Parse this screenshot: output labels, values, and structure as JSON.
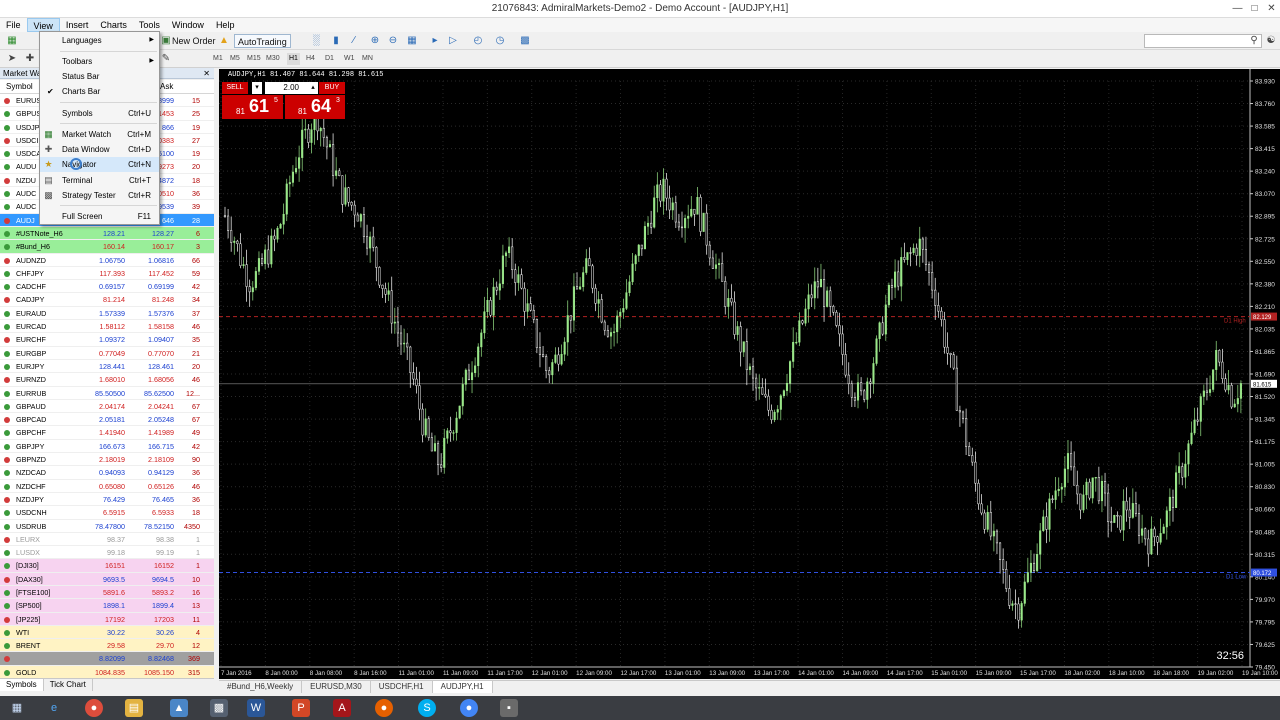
{
  "window": {
    "title": "21076843: AdmiralMarkets-Demo2 - Demo Account - [AUDJPY,H1]"
  },
  "menubar": [
    "File",
    "View",
    "Insert",
    "Charts",
    "Tools",
    "Window",
    "Help"
  ],
  "toolbar": {
    "new_order": "New Order",
    "autotrading": "AutoTrading"
  },
  "timeframes": [
    "M1",
    "M5",
    "M15",
    "M30",
    "H1",
    "H4",
    "D1",
    "W1",
    "MN"
  ],
  "view_menu": [
    {
      "label": "Languages",
      "shortcut": "",
      "submenu": true
    },
    {
      "label": "Toolbars",
      "shortcut": "",
      "submenu": true
    },
    {
      "label": "Status Bar",
      "shortcut": ""
    },
    {
      "label": "Charts Bar",
      "shortcut": "",
      "checked": true
    },
    {
      "label": "Symbols",
      "shortcut": "Ctrl+U"
    },
    {
      "label": "Market Watch",
      "shortcut": "Ctrl+M"
    },
    {
      "label": "Data Window",
      "shortcut": "Ctrl+D"
    },
    {
      "label": "Navigator",
      "shortcut": "Ctrl+N"
    },
    {
      "label": "Terminal",
      "shortcut": "Ctrl+T"
    },
    {
      "label": "Strategy Tester",
      "shortcut": "Ctrl+R"
    },
    {
      "label": "Full Screen",
      "shortcut": "F11"
    }
  ],
  "market_watch": {
    "title": "Market Wa",
    "columns": {
      "symbol": "Symbol",
      "ask": "Ask"
    },
    "rows": [
      {
        "symbol": "EURUS",
        "bid": "",
        "ask": "8999",
        "spread": "15",
        "bg": "#ffffff"
      },
      {
        "symbol": "GBPUS",
        "bid": "",
        "ask": "1453",
        "spread": "25",
        "bg": "#ffffff"
      },
      {
        "symbol": "USDJP",
        "bid": "",
        "ask": "866",
        "spread": "19",
        "bg": "#ffffff"
      },
      {
        "symbol": "USDCI",
        "bid": "",
        "ask": "0383",
        "spread": "27",
        "bg": "#ffffff"
      },
      {
        "symbol": "USDCA",
        "bid": "",
        "ask": "5100",
        "spread": "19",
        "bg": "#ffffff"
      },
      {
        "symbol": "AUDU",
        "bid": "",
        "ask": "9273",
        "spread": "20",
        "bg": "#ffffff"
      },
      {
        "symbol": "NZDU",
        "bid": "",
        "ask": "4872",
        "spread": "18",
        "bg": "#ffffff"
      },
      {
        "symbol": "AUDC",
        "bid": "",
        "ask": "0510",
        "spread": "36",
        "bg": "#ffffff"
      },
      {
        "symbol": "AUDC",
        "bid": "",
        "ask": "9539",
        "spread": "39",
        "bg": "#ffffff"
      },
      {
        "symbol": "AUDJ",
        "bid": "",
        "ask": "646",
        "spread": "28",
        "bg": "#3399ff"
      },
      {
        "symbol": "#USTNote_H6",
        "bid": "128.21",
        "ask": "128.27",
        "spread": "6",
        "bg": "#99ee99"
      },
      {
        "symbol": "#Bund_H6",
        "bid": "160.14",
        "ask": "160.17",
        "spread": "3",
        "bg": "#99ee99"
      },
      {
        "symbol": "AUDNZD",
        "bid": "1.06750",
        "ask": "1.06816",
        "spread": "66",
        "bg": "#ffffff"
      },
      {
        "symbol": "CHFJPY",
        "bid": "117.393",
        "ask": "117.452",
        "spread": "59",
        "bg": "#ffffff"
      },
      {
        "symbol": "CADCHF",
        "bid": "0.69157",
        "ask": "0.69199",
        "spread": "42",
        "bg": "#ffffff"
      },
      {
        "symbol": "CADJPY",
        "bid": "81.214",
        "ask": "81.248",
        "spread": "34",
        "bg": "#ffffff"
      },
      {
        "symbol": "EURAUD",
        "bid": "1.57339",
        "ask": "1.57376",
        "spread": "37",
        "bg": "#ffffff"
      },
      {
        "symbol": "EURCAD",
        "bid": "1.58112",
        "ask": "1.58158",
        "spread": "46",
        "bg": "#ffffff"
      },
      {
        "symbol": "EURCHF",
        "bid": "1.09372",
        "ask": "1.09407",
        "spread": "35",
        "bg": "#ffffff"
      },
      {
        "symbol": "EURGBP",
        "bid": "0.77049",
        "ask": "0.77070",
        "spread": "21",
        "bg": "#ffffff"
      },
      {
        "symbol": "EURJPY",
        "bid": "128.441",
        "ask": "128.461",
        "spread": "20",
        "bg": "#ffffff"
      },
      {
        "symbol": "EURNZD",
        "bid": "1.68010",
        "ask": "1.68056",
        "spread": "46",
        "bg": "#ffffff"
      },
      {
        "symbol": "EURRUB",
        "bid": "85.50500",
        "ask": "85.62500",
        "spread": "12...",
        "bg": "#ffffff"
      },
      {
        "symbol": "GBPAUD",
        "bid": "2.04174",
        "ask": "2.04241",
        "spread": "67",
        "bg": "#ffffff"
      },
      {
        "symbol": "GBPCAD",
        "bid": "2.05181",
        "ask": "2.05248",
        "spread": "67",
        "bg": "#ffffff"
      },
      {
        "symbol": "GBPCHF",
        "bid": "1.41940",
        "ask": "1.41989",
        "spread": "49",
        "bg": "#ffffff"
      },
      {
        "symbol": "GBPJPY",
        "bid": "166.673",
        "ask": "166.715",
        "spread": "42",
        "bg": "#ffffff"
      },
      {
        "symbol": "GBPNZD",
        "bid": "2.18019",
        "ask": "2.18109",
        "spread": "90",
        "bg": "#ffffff"
      },
      {
        "symbol": "NZDCAD",
        "bid": "0.94093",
        "ask": "0.94129",
        "spread": "36",
        "bg": "#ffffff"
      },
      {
        "symbol": "NZDCHF",
        "bid": "0.65080",
        "ask": "0.65126",
        "spread": "46",
        "bg": "#ffffff"
      },
      {
        "symbol": "NZDJPY",
        "bid": "76.429",
        "ask": "76.465",
        "spread": "36",
        "bg": "#ffffff"
      },
      {
        "symbol": "USDCNH",
        "bid": "6.5915",
        "ask": "6.5933",
        "spread": "18",
        "bg": "#ffffff"
      },
      {
        "symbol": "USDRUB",
        "bid": "78.47800",
        "ask": "78.52150",
        "spread": "4350",
        "bg": "#ffffff"
      },
      {
        "symbol": "LEURX",
        "bid": "98.37",
        "ask": "98.38",
        "spread": "1",
        "bg": "#ffffff",
        "grey": true
      },
      {
        "symbol": "LUSDX",
        "bid": "99.18",
        "ask": "99.19",
        "spread": "1",
        "bg": "#ffffff",
        "grey": true
      },
      {
        "symbol": "[DJI30]",
        "bid": "16151",
        "ask": "16152",
        "spread": "1",
        "bg": "#f7d3f0"
      },
      {
        "symbol": "[DAX30]",
        "bid": "9693.5",
        "ask": "9694.5",
        "spread": "10",
        "bg": "#f7d3f0"
      },
      {
        "symbol": "[FTSE100]",
        "bid": "5891.6",
        "ask": "5893.2",
        "spread": "16",
        "bg": "#f7d3f0"
      },
      {
        "symbol": "[SP500]",
        "bid": "1898.1",
        "ask": "1899.4",
        "spread": "13",
        "bg": "#f7d3f0"
      },
      {
        "symbol": "[JP225]",
        "bid": "17192",
        "ask": "17203",
        "spread": "11",
        "bg": "#f7d3f0"
      },
      {
        "symbol": "WTI",
        "bid": "30.22",
        "ask": "30.26",
        "spread": "4",
        "bg": "#fff3c4"
      },
      {
        "symbol": "BRENT",
        "bid": "29.58",
        "ask": "29.70",
        "spread": "12",
        "bg": "#fff3c4"
      },
      {
        "symbol": "",
        "bid": "8.82099",
        "ask": "8.82468",
        "spread": "369",
        "bg": "#a0a0a0"
      },
      {
        "symbol": "GOLD",
        "bid": "1084.835",
        "ask": "1085.150",
        "spread": "315",
        "bg": "#fff3c4"
      }
    ],
    "tabs": [
      "Symbols",
      "Tick Chart"
    ]
  },
  "chart": {
    "header": "AUDJPY,H1  81.407 81.644 81.298 81.615",
    "one_click": {
      "sell": "SELL",
      "buy": "BUY",
      "lot": "2.00",
      "sell_prefix": "81",
      "sell_big": "61",
      "sell_sup": "5",
      "buy_prefix": "81",
      "buy_big": "64",
      "buy_sup": "3"
    },
    "timer": "32:56",
    "hline_labels": {
      "high": "D1 High",
      "low": "D1 Low"
    },
    "hline_tags": {
      "high": "82.129",
      "current": "81.615",
      "low": "80.172"
    }
  },
  "chart_data": {
    "type": "bar",
    "title": "AUDJPY,H1",
    "y_ticks": [
      "83.930",
      "83.760",
      "83.585",
      "83.415",
      "83.240",
      "83.070",
      "82.895",
      "82.725",
      "82.550",
      "82.380",
      "82.210",
      "82.035",
      "81.865",
      "81.690",
      "81.520",
      "81.345",
      "81.175",
      "81.005",
      "80.830",
      "80.660",
      "80.485",
      "80.315",
      "80.140",
      "79.970",
      "79.795",
      "79.625",
      "79.450"
    ],
    "x_ticks": [
      "7 Jan 2016",
      "8 Jan 00:00",
      "8 Jan 08:00",
      "8 Jan 16:00",
      "11 Jan 01:00",
      "11 Jan 09:00",
      "11 Jan 17:00",
      "12 Jan 01:00",
      "12 Jan 09:00",
      "12 Jan 17:00",
      "13 Jan 01:00",
      "13 Jan 09:00",
      "13 Jan 17:00",
      "14 Jan 01:00",
      "14 Jan 09:00",
      "14 Jan 17:00",
      "15 Jan 01:00",
      "15 Jan 09:00",
      "15 Jan 17:00",
      "18 Jan 02:00",
      "18 Jan 10:00",
      "18 Jan 18:00",
      "19 Jan 02:00",
      "19 Jan 10:00"
    ],
    "ylim": [
      79.45,
      83.93
    ],
    "close_series": [
      82.9,
      82.75,
      82.55,
      82.4,
      82.45,
      82.6,
      82.7,
      82.9,
      83.2,
      83.4,
      83.55,
      83.7,
      83.5,
      83.3,
      83.1,
      83.0,
      82.95,
      82.8,
      82.6,
      82.4,
      82.2,
      82.0,
      81.8,
      81.6,
      81.3,
      81.1,
      81.0,
      81.2,
      81.4,
      81.6,
      81.8,
      82.0,
      82.2,
      82.4,
      82.6,
      82.5,
      82.3,
      82.1,
      81.9,
      81.7,
      81.8,
      82.0,
      82.2,
      82.4,
      82.5,
      82.3,
      82.1,
      82.0,
      82.2,
      82.4,
      82.6,
      82.8,
      83.0,
      83.1,
      83.0,
      82.9,
      82.95,
      83.0,
      82.8,
      82.6,
      82.4,
      82.2,
      82.0,
      81.8,
      81.6,
      81.5,
      81.4,
      81.5,
      81.7,
      81.9,
      82.1,
      82.3,
      82.4,
      82.2,
      82.0,
      81.8,
      81.6,
      81.5,
      81.7,
      81.9,
      82.2,
      82.4,
      82.5,
      82.6,
      82.7,
      82.5,
      82.3,
      82.0,
      81.7,
      81.4,
      81.1,
      80.8,
      80.6,
      80.4,
      80.2,
      80.0,
      79.9,
      80.1,
      80.3,
      80.5,
      80.7,
      80.9,
      81.0,
      80.8,
      80.7,
      80.9,
      80.8,
      80.6,
      80.5,
      80.7,
      80.6,
      80.5,
      80.4,
      80.5,
      80.6,
      80.8,
      81.0,
      81.2,
      81.4,
      81.6,
      81.8,
      81.7,
      81.5,
      81.615
    ]
  },
  "chart_tabs": [
    "#Bund_H6,Weekly",
    "EURUSD,M30",
    "USDCHF,H1",
    "AUDJPY,H1"
  ],
  "colors": {
    "bull": "#9be88a",
    "bear": "#ffffff",
    "menu_hl": "#d5e8fa",
    "sell_red": "#cc0000"
  }
}
